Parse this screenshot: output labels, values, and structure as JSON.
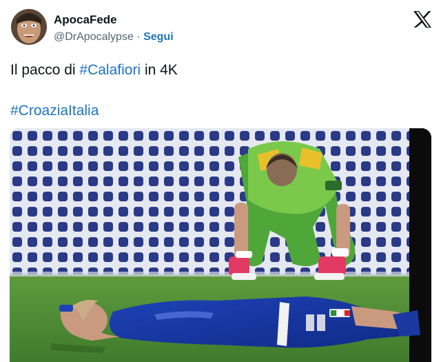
{
  "user": {
    "display_name": "ApocaFede",
    "handle": "@DrApocalypse",
    "separator": "·",
    "follow_label": "Segui"
  },
  "brand": {
    "logo_icon": "x-logo-icon"
  },
  "tweet": {
    "text_before": "Il pacco di ",
    "hashtag_1": "#Calafiori",
    "text_after": " in 4K",
    "hashtag_2": "#CroaziaItalia"
  },
  "media": {
    "type": "photo"
  },
  "colors": {
    "text": "#0f1419",
    "secondary_text": "#536471",
    "link": "#1d74bf",
    "background": "#ffffff"
  }
}
